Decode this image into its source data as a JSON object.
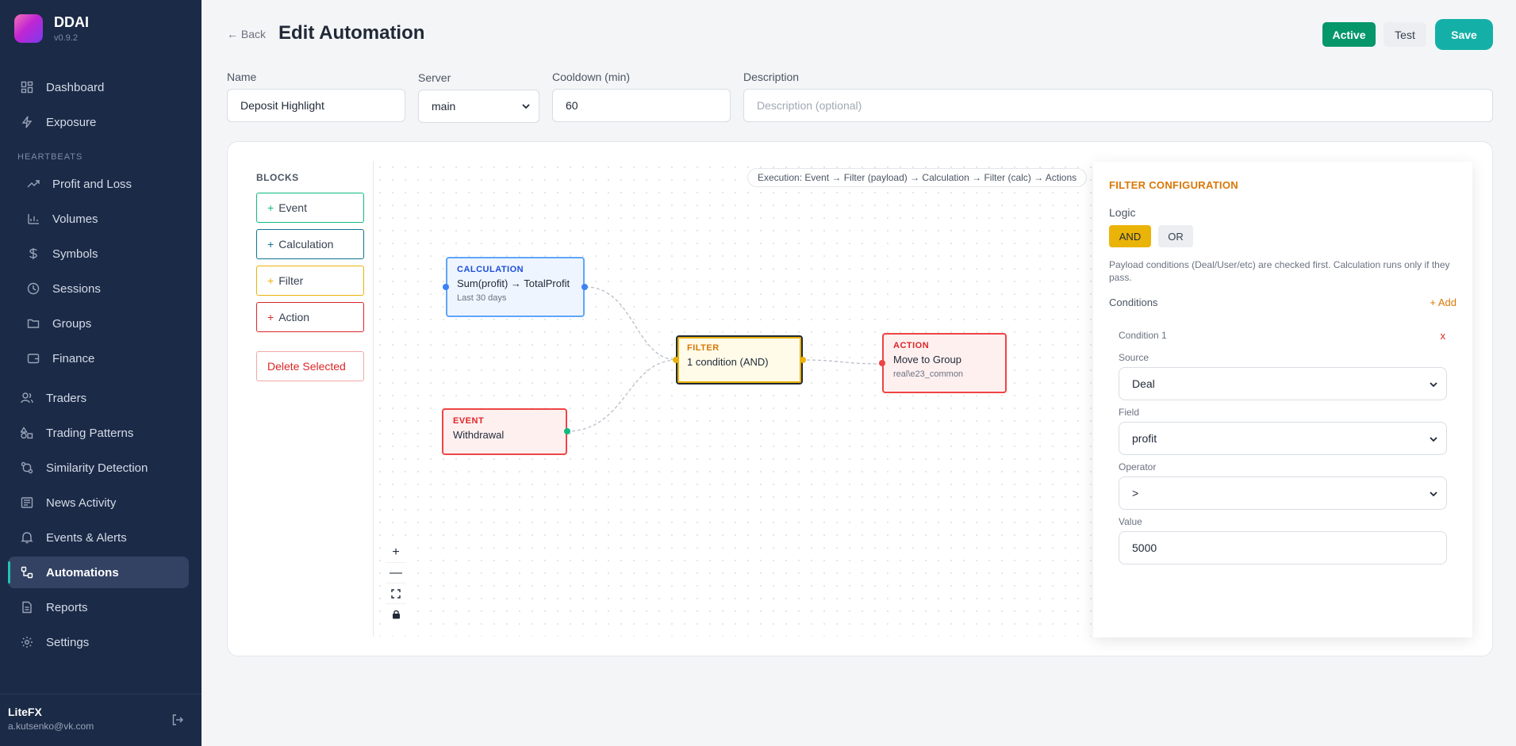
{
  "brand": {
    "name": "DDAI",
    "version": "v0.9.2"
  },
  "nav": {
    "top": [
      {
        "label": "Dashboard",
        "icon": "grid-icon"
      },
      {
        "label": "Exposure",
        "icon": "lightning-icon"
      }
    ],
    "section_label": "HEARTBEATS",
    "heartbeats": [
      {
        "label": "Profit and Loss",
        "icon": "trend-icon"
      },
      {
        "label": "Volumes",
        "icon": "bar-chart-icon"
      },
      {
        "label": "Symbols",
        "icon": "dollar-icon"
      },
      {
        "label": "Sessions",
        "icon": "clock-icon"
      },
      {
        "label": "Groups",
        "icon": "folder-icon"
      },
      {
        "label": "Finance",
        "icon": "wallet-icon"
      }
    ],
    "bottom": [
      {
        "label": "Traders",
        "icon": "users-icon"
      },
      {
        "label": "Trading Patterns",
        "icon": "shapes-icon"
      },
      {
        "label": "Similarity Detection",
        "icon": "git-icon"
      },
      {
        "label": "News Activity",
        "icon": "newspaper-icon"
      },
      {
        "label": "Events & Alerts",
        "icon": "bell-icon"
      },
      {
        "label": "Automations",
        "icon": "workflow-icon",
        "active": true
      },
      {
        "label": "Reports",
        "icon": "file-icon"
      },
      {
        "label": "Settings",
        "icon": "gear-icon"
      }
    ]
  },
  "user": {
    "name": "LiteFX",
    "email": "a.kutsenko@vk.com"
  },
  "header": {
    "back": "← Back",
    "title": "Edit Automation",
    "active": "Active",
    "test": "Test",
    "save": "Save"
  },
  "form": {
    "name_label": "Name",
    "name_value": "Deposit Highlight",
    "server_label": "Server",
    "server_value": "main",
    "cooldown_label": "Cooldown (min)",
    "cooldown_value": "60",
    "description_label": "Description",
    "description_placeholder": "Description (optional)"
  },
  "blocks": {
    "title": "BLOCKS",
    "event": "Event",
    "calculation": "Calculation",
    "filter": "Filter",
    "action": "Action",
    "delete": "Delete Selected",
    "colors": {
      "event": "#10b981",
      "calculation": "#0e7490",
      "filter": "#eab308",
      "action": "#dc2626"
    }
  },
  "canvas": {
    "execution": "Execution: Event → Filter (payload) → Calculation → Filter (calc) → Actions",
    "nodes": {
      "calculation": {
        "type": "CALCULATION",
        "title": "Sum(profit) → TotalProfit",
        "sub": "Last 30 days"
      },
      "event": {
        "type": "EVENT",
        "title": "Withdrawal"
      },
      "filter": {
        "type": "FILTER",
        "title": "1 condition (AND)"
      },
      "action": {
        "type": "ACTION",
        "title": "Move to Group",
        "sub": "real\\e23_common"
      }
    }
  },
  "config": {
    "title": "FILTER CONFIGURATION",
    "logic_label": "Logic",
    "and": "AND",
    "or": "OR",
    "note": "Payload conditions (Deal/User/etc) are checked first. Calculation runs only if they pass.",
    "conditions_label": "Conditions",
    "add": "+ Add",
    "condition": {
      "label": "Condition 1",
      "remove": "x",
      "source_label": "Source",
      "source": "Deal",
      "field_label": "Field",
      "field": "profit",
      "operator_label": "Operator",
      "operator": ">",
      "value_label": "Value",
      "value": "5000"
    }
  }
}
